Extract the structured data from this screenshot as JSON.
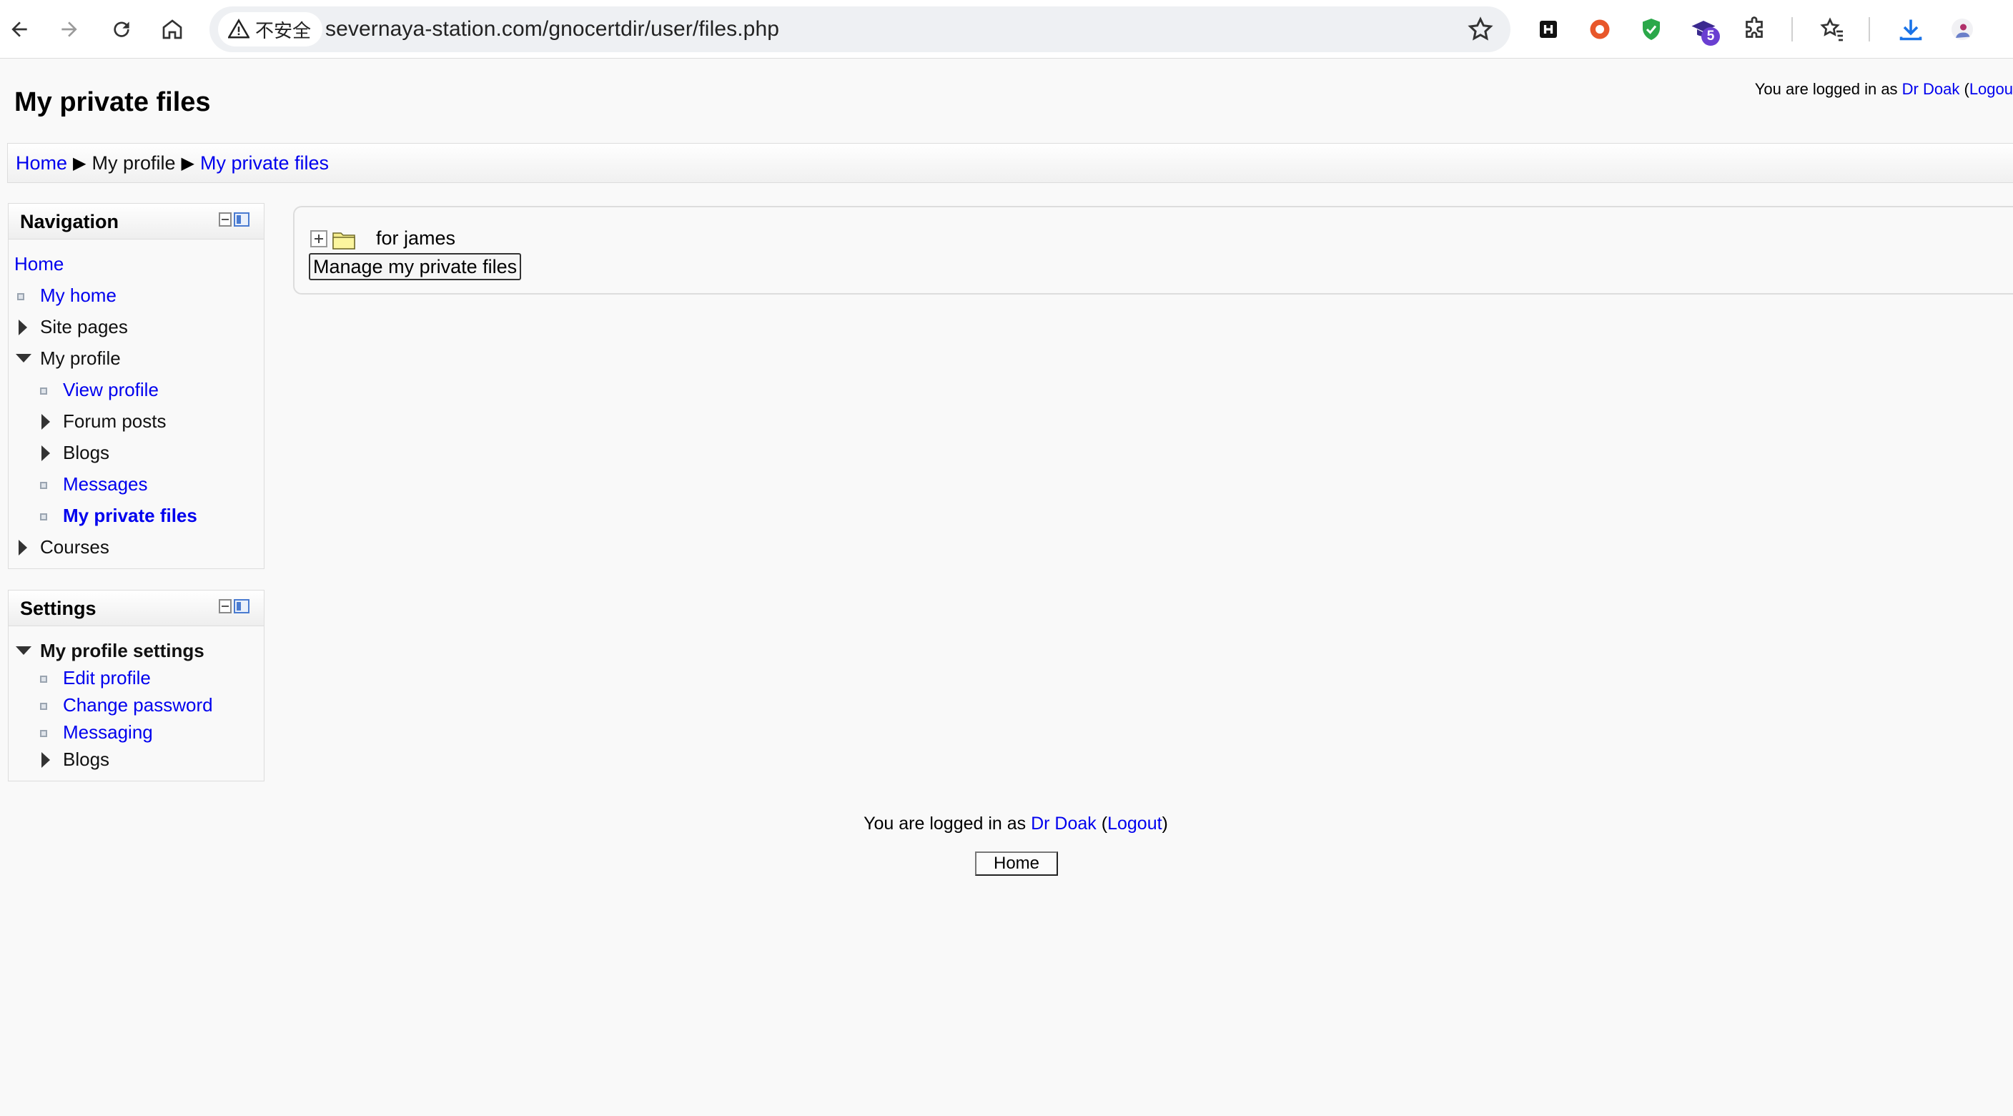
{
  "browser": {
    "security_label": "不安全",
    "url": "severnaya-station.com/gnocertdir/user/files.php",
    "extension_badge": "5"
  },
  "page": {
    "title": "My private files",
    "login_prefix": "You are logged in as ",
    "user_name": "Dr Doak",
    "logout_label": "Logout",
    "login_top_logout_truncated": "Logou",
    "paren_open": "(",
    "paren_close": ")"
  },
  "breadcrumb": {
    "items": [
      "Home",
      "My profile",
      "My private files"
    ],
    "separator": "▶"
  },
  "navigation_block": {
    "title": "Navigation",
    "items": {
      "home": "Home",
      "my_home": "My home",
      "site_pages": "Site pages",
      "my_profile": "My profile",
      "view_profile": "View profile",
      "forum_posts": "Forum posts",
      "blogs": "Blogs",
      "messages": "Messages",
      "my_private_files": "My private files",
      "courses": "Courses"
    }
  },
  "settings_block": {
    "title": "Settings",
    "items": {
      "my_profile_settings": "My profile settings",
      "edit_profile": "Edit profile",
      "change_password": "Change password",
      "messaging": "Messaging",
      "blogs": "Blogs"
    }
  },
  "main": {
    "folder_name": "for james",
    "manage_button": "Manage my private files"
  },
  "footer": {
    "home_button": "Home"
  },
  "colors": {
    "link": "#0000ee",
    "background": "#f9f9f9"
  }
}
